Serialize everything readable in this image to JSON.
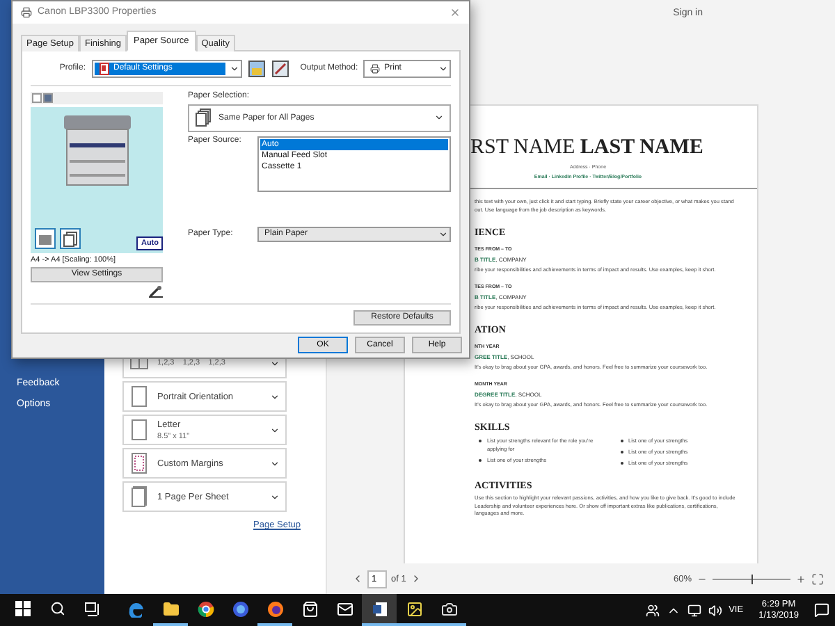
{
  "word": {
    "sign_in": "Sign in",
    "sidebar": [
      {
        "label": "Feedback"
      },
      {
        "label": "Options"
      }
    ],
    "settings": [
      {
        "kind": "collated",
        "subtitle": "1,2,3    1,2,3    1,2,3"
      },
      {
        "kind": "orientation",
        "title": "Portrait Orientation"
      },
      {
        "kind": "paper",
        "title": "Letter",
        "subtitle": "8.5\" x 11\""
      },
      {
        "kind": "margins",
        "title": "Custom Margins"
      },
      {
        "kind": "sheet",
        "title": "1 Page Per Sheet"
      }
    ],
    "page_setup_link": "Page Setup",
    "document": {
      "name": "RST NAME **LAST NAME**",
      "contact": "Address · Phone",
      "links": "Email · LinkedIn Profile · Twitter/Blog/Portfolio",
      "objective": "this text with your own, just click it and start typing. Briefly state your career objective, or what makes you stand out. Use language from the job description as keywords.",
      "sections": [
        {
          "kind": "entries",
          "heading": "IENCE",
          "entries": [
            {
              "dates": "TES FROM – TO",
              "title": "B TITLE",
              "org": ", COMPANY",
              "text": "ribe your responsibilities and achievements in terms of impact and results. Use examples, keep it short."
            },
            {
              "dates": "TES FROM – TO",
              "title": "B TITLE",
              "org": ", COMPANY",
              "text": "ribe your responsibilities and achievements in terms of impact and results. Use examples, keep it short."
            }
          ]
        },
        {
          "kind": "entries",
          "heading": "ATION",
          "entries": [
            {
              "dates": "NTH YEAR",
              "title": "GREE TITLE",
              "org": ", SCHOOL",
              "text": "It's okay to brag about your GPA, awards, and honors. Feel free to summarize your coursework too."
            },
            {
              "dates": "MONTH YEAR",
              "title": "DEGREE TITLE",
              "org": ", SCHOOL",
              "text": "It's okay to brag about your GPA, awards, and honors. Feel free to summarize your coursework too."
            }
          ]
        },
        {
          "kind": "bullets",
          "heading": "SKILLS",
          "columns": [
            [
              "List your strengths relevant for the role you're applying for",
              "List one of your strengths"
            ],
            [
              "List one of your strengths",
              "List one of your strengths",
              "List one of your strengths"
            ]
          ]
        },
        {
          "kind": "text",
          "heading": "ACTIVITIES",
          "text": "Use this section to highlight your relevant passions, activities, and how you like to give back. It's good to include Leadership and volunteer experiences here. Or show off important extras like publications, certifications, languages and more."
        }
      ]
    },
    "page_nav": {
      "page": "1",
      "of": "of 1"
    },
    "zoom": {
      "value": "60%",
      "level": 0.5
    }
  },
  "dialog": {
    "title": "Canon LBP3300 Properties",
    "tabs": [
      {
        "label": "Page Setup",
        "selected": false
      },
      {
        "label": "Finishing",
        "selected": false
      },
      {
        "label": "Paper Source",
        "selected": true
      },
      {
        "label": "Quality",
        "selected": false
      }
    ],
    "profile_label": "Profile:",
    "profile": "Default Settings",
    "output_label": "Output Method:",
    "output": "Print",
    "preview": {
      "badge": "Auto",
      "caption": "A4 -> A4 [Scaling: 100%]",
      "button": "View Settings"
    },
    "paper_selection_label": "Paper Selection:",
    "paper_selection": "Same Paper for All Pages",
    "paper_source_label": "Paper Source:",
    "paper_sources": [
      {
        "label": "Auto",
        "selected": true
      },
      {
        "label": "Manual Feed Slot",
        "selected": false
      },
      {
        "label": "Cassette 1",
        "selected": false
      }
    ],
    "paper_type_label": "Paper Type:",
    "paper_type": "Plain Paper",
    "restore": "Restore Defaults",
    "buttons": [
      "OK",
      "Cancel",
      "Help"
    ]
  },
  "taskbar": {
    "apps": [
      {
        "kind": "edge",
        "running": false,
        "selected": false
      },
      {
        "kind": "folder",
        "running": true,
        "selected": false
      },
      {
        "kind": "chrome",
        "running": false,
        "selected": false
      },
      {
        "kind": "firefox-dev",
        "running": false,
        "selected": false
      },
      {
        "kind": "firefox",
        "running": true,
        "selected": false
      },
      {
        "kind": "store",
        "running": false,
        "selected": false
      },
      {
        "kind": "mail",
        "running": false,
        "selected": false
      },
      {
        "kind": "word",
        "running": true,
        "selected": true
      },
      {
        "kind": "photo",
        "running": true,
        "selected": false
      },
      {
        "kind": "camera",
        "running": true,
        "selected": false
      }
    ],
    "language": "VIE",
    "time": "6:29 PM",
    "date": "1/13/2019"
  }
}
